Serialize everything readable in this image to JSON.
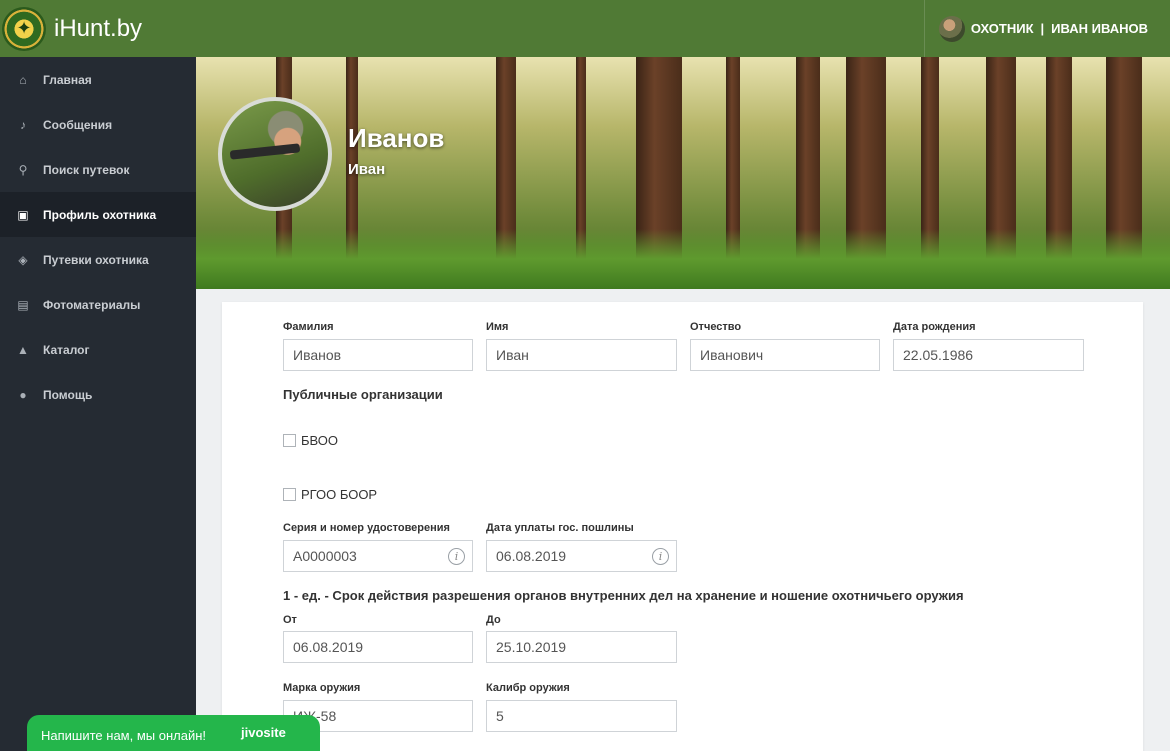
{
  "brand": {
    "name": "iHunt.by",
    "logo_icon": "emblem-icon"
  },
  "topbar": {
    "role": "ОХОТНИК",
    "separator": "|",
    "user_name": "ИВАН ИВАНОВ"
  },
  "sidebar": {
    "items": [
      {
        "label": "Главная",
        "icon": "home-icon",
        "glyph": "⌂",
        "active": false
      },
      {
        "label": "Сообщения",
        "icon": "bell-icon",
        "glyph": "♪",
        "active": false
      },
      {
        "label": "Поиск путевок",
        "icon": "search-icon",
        "glyph": "⚲",
        "active": false
      },
      {
        "label": "Профиль охотника",
        "icon": "id-card-icon",
        "glyph": "▣",
        "active": true
      },
      {
        "label": "Путевки охотника",
        "icon": "target-icon",
        "glyph": "◈",
        "active": false
      },
      {
        "label": "Фотоматериалы",
        "icon": "photos-icon",
        "glyph": "▤",
        "active": false
      },
      {
        "label": "Каталог",
        "icon": "catalog-icon",
        "glyph": "▲",
        "active": false
      },
      {
        "label": "Помощь",
        "icon": "info-icon",
        "glyph": "●",
        "active": false
      }
    ]
  },
  "profile": {
    "last_name": "Иванов",
    "first_name": "Иван"
  },
  "form": {
    "surname": {
      "label": "Фамилия",
      "value": "Иванов"
    },
    "name": {
      "label": "Имя",
      "value": "Иван"
    },
    "patronymic": {
      "label": "Отчество",
      "value": "Иванович"
    },
    "birth_date": {
      "label": "Дата рождения",
      "value": "22.05.1986"
    },
    "orgs_title": "Публичные организации",
    "orgs": [
      {
        "label": "БВОО",
        "checked": false
      },
      {
        "label": "РГОО БООР",
        "checked": false
      }
    ],
    "certificate": {
      "label": "Серия и номер удостоверения",
      "value": "А0000003"
    },
    "fee_date": {
      "label": "Дата уплаты гос. пошлины",
      "value": "06.08.2019"
    },
    "permit_title": "1 - ед. - Срок действия разрешения органов внутренних дел на хранение и ношение охотничьего оружия",
    "from": {
      "label": "От",
      "value": "06.08.2019"
    },
    "to": {
      "label": "До",
      "value": "25.10.2019"
    },
    "weapon_brand": {
      "label": "Марка оружия",
      "value": "ИЖ-58"
    },
    "weapon_caliber": {
      "label": "Калибр оружия",
      "value": "5"
    }
  },
  "chat": {
    "text": "Напишите нам, мы онлайн!",
    "brand": "jivosite"
  },
  "colors": {
    "topbar": "#507a35",
    "sidebar": "#252b33",
    "chat": "#24b64b"
  }
}
